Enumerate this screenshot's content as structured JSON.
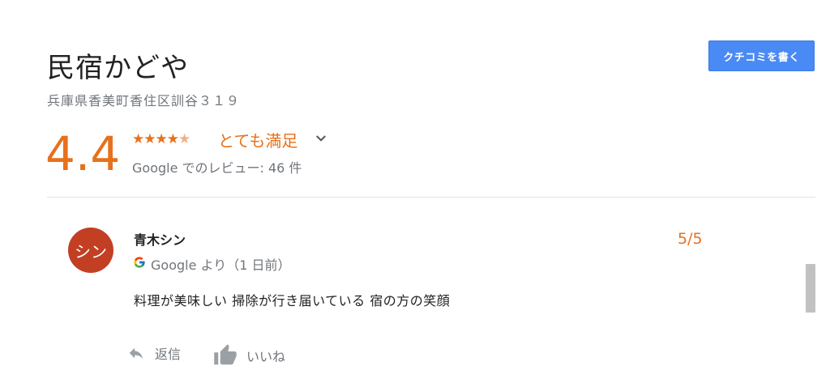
{
  "business": {
    "name": "民宿かどや",
    "address": "兵庫県香美町香住区訓谷３１９"
  },
  "write_review_button": "クチコミを書く",
  "rating": {
    "score": "4.4",
    "stars": 4.4,
    "label": "とても満足",
    "review_count": "Google でのレビュー: 46 件"
  },
  "review": {
    "avatar_text": "シン",
    "reviewer": "青木シン",
    "score": "5/5",
    "source": "Google より（1 日前）",
    "text": "料理が美味しい 掃除が行き届いている 宿の方の笑顔"
  },
  "actions": {
    "reply": "返信",
    "like": "いいね"
  },
  "colors": {
    "accent": "#e7711b",
    "button": "#4a8af4",
    "avatar": "#c23f24"
  }
}
